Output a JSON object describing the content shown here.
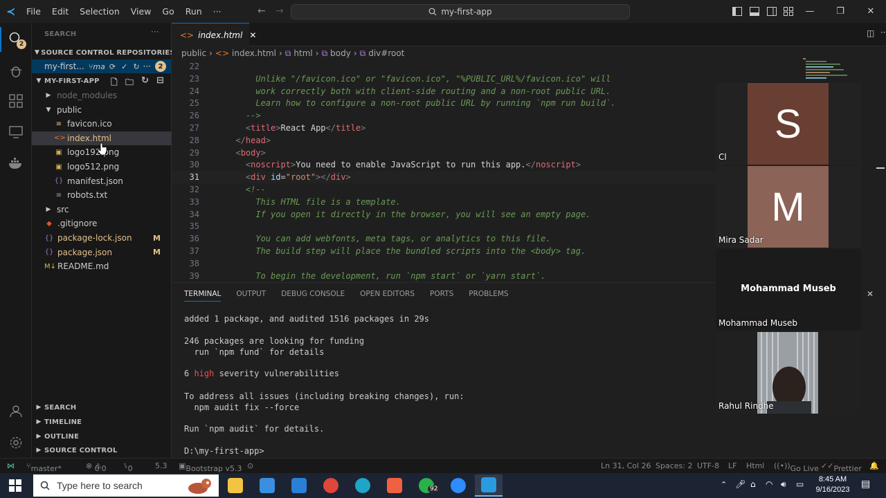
{
  "titlebar": {
    "menu": [
      "File",
      "Edit",
      "Selection",
      "View",
      "Go",
      "Run",
      "···"
    ],
    "search": "my-first-app"
  },
  "activity": {
    "badge": "2"
  },
  "sidebar": {
    "search_header": "SEARCH",
    "scm_header": "SOURCE CONTROL REPOSITORIES",
    "repo_name": "my-first...",
    "repo_branch": "ma",
    "repo_badge": "2",
    "explorer_header": "MY-FIRST-APP",
    "tree": [
      {
        "label": "node_modules",
        "indent": 1,
        "type": "folder-closed",
        "dim": true
      },
      {
        "label": "public",
        "indent": 1,
        "type": "folder-open"
      },
      {
        "label": "favicon.ico",
        "indent": 2,
        "type": "ico"
      },
      {
        "label": "index.html",
        "indent": 2,
        "type": "html",
        "selected": true
      },
      {
        "label": "logo192.png",
        "indent": 2,
        "type": "png"
      },
      {
        "label": "logo512.png",
        "indent": 2,
        "type": "png"
      },
      {
        "label": "manifest.json",
        "indent": 2,
        "type": "json"
      },
      {
        "label": "robots.txt",
        "indent": 2,
        "type": "txt"
      },
      {
        "label": "src",
        "indent": 1,
        "type": "folder-closed"
      },
      {
        "label": ".gitignore",
        "indent": 1,
        "type": "git"
      },
      {
        "label": "package-lock.json",
        "indent": 1,
        "type": "json",
        "badge": "M"
      },
      {
        "label": "package.json",
        "indent": 1,
        "type": "json",
        "badge": "M"
      },
      {
        "label": "README.md",
        "indent": 1,
        "type": "md"
      }
    ],
    "bottom_sections": [
      "SEARCH",
      "TIMELINE",
      "OUTLINE",
      "SOURCE CONTROL"
    ]
  },
  "editor": {
    "tab": "index.html",
    "breadcrumb": [
      "public",
      "index.html",
      "html",
      "body",
      "div#root"
    ],
    "lines": [
      {
        "n": "22",
        "t": ""
      },
      {
        "n": "23",
        "t": "      Unlike \"/favicon.ico\" or \"favicon.ico\", \"%PUBLIC_URL%/favicon.ico\" will",
        "c": "com"
      },
      {
        "n": "24",
        "t": "      work correctly both with client-side routing and a non-root public URL.",
        "c": "com"
      },
      {
        "n": "25",
        "t": "      Learn how to configure a non-root public URL by running `npm run build`.",
        "c": "com"
      },
      {
        "n": "26",
        "t": "    -->",
        "c": "com"
      },
      {
        "n": "27",
        "t": "    <title>React App</title>",
        "c": "tagline"
      },
      {
        "n": "28",
        "t": "  </head>",
        "c": "tagline"
      },
      {
        "n": "29",
        "t": "  <body>",
        "c": "tagline"
      },
      {
        "n": "30",
        "t": "    <noscript>You need to enable JavaScript to run this app.</noscript>",
        "c": "tagline"
      },
      {
        "n": "31",
        "t": "    <div id=\"root\"></div>",
        "c": "tagline",
        "cur": true
      },
      {
        "n": "32",
        "t": "    <!--",
        "c": "com"
      },
      {
        "n": "33",
        "t": "      This HTML file is a template.",
        "c": "com"
      },
      {
        "n": "34",
        "t": "      If you open it directly in the browser, you will see an empty page.",
        "c": "com"
      },
      {
        "n": "35",
        "t": ""
      },
      {
        "n": "36",
        "t": "      You can add webfonts, meta tags, or analytics to this file.",
        "c": "com"
      },
      {
        "n": "37",
        "t": "      The build step will place the bundled scripts into the <body> tag.",
        "c": "com"
      },
      {
        "n": "38",
        "t": ""
      },
      {
        "n": "39",
        "t": "      To begin the development, run `npm start` or `yarn start`.",
        "c": "com"
      }
    ]
  },
  "panel": {
    "tabs": [
      "TERMINAL",
      "OUTPUT",
      "DEBUG CONSOLE",
      "OPEN EDITORS",
      "PORTS",
      "PROBLEMS"
    ],
    "terminal": [
      "added 1 package, and audited 1516 packages in 29s",
      "",
      "246 packages are looking for funding",
      "  run `npm fund` for details",
      "",
      "6 high severity vulnerabilities",
      "",
      "To address all issues (including breaking changes), run:",
      "  npm audit fix --force",
      "",
      "Run `npm audit` for details.",
      "",
      "D:\\my-first-app>"
    ]
  },
  "meeting": {
    "tiles": [
      {
        "initial": "S",
        "name": "Cl",
        "color": "#6a3f33"
      },
      {
        "initial": "M",
        "name": "Mira Sadar",
        "color": "#8b6357"
      },
      {
        "title": "Mohammad Museb",
        "name": "Mohammad Museb"
      },
      {
        "name": "Rahul Rindhe",
        "video": true
      }
    ]
  },
  "statusbar": {
    "branch": "master*",
    "errors": "0",
    "warnings": "0",
    "ports": "0",
    "version": "5.3",
    "bootstrap": "Bootstrap v5.3",
    "position": "Ln 31, Col 26",
    "spaces": "Spaces: 2",
    "encoding": "UTF-8",
    "eol": "LF",
    "language": "Html",
    "golive": "Go Live",
    "prettier": "Prettier"
  },
  "taskbar": {
    "search_placeholder": "Type here to search",
    "whatsapp_badge": "92",
    "time": "8:45 AM",
    "date": "9/16/2023"
  },
  "colors": {
    "accent": "#0078d4",
    "high": "#f14c4c",
    "modified": "#e2c08d"
  }
}
